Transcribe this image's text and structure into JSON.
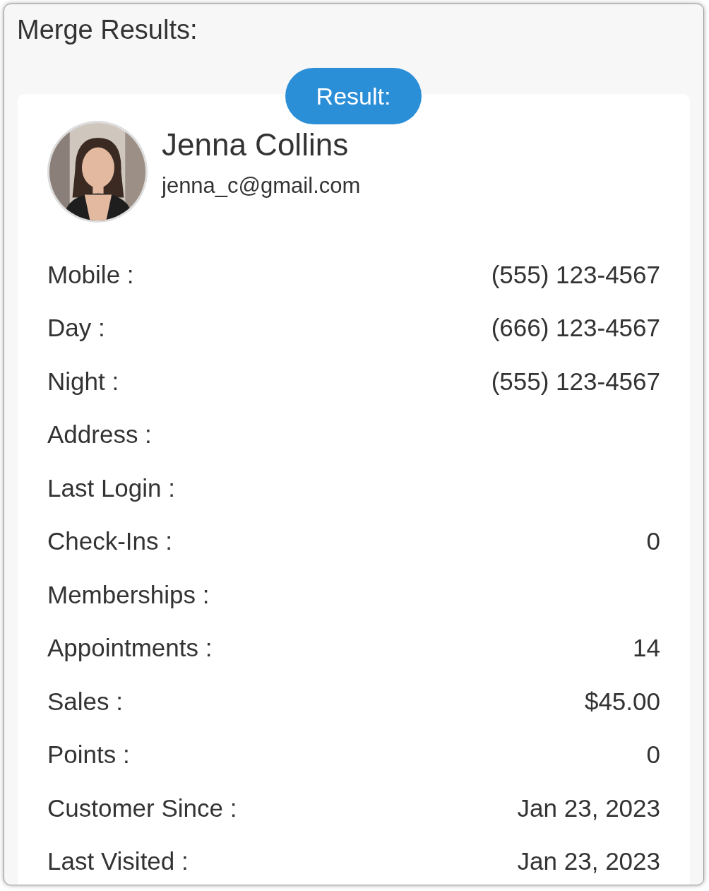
{
  "title": "Merge Results:",
  "result_badge": "Result:",
  "profile": {
    "name": "Jenna Collins",
    "email": "jenna_c@gmail.com"
  },
  "fields": [
    {
      "label": "Mobile :",
      "value": "(555) 123-4567"
    },
    {
      "label": "Day :",
      "value": "(666) 123-4567"
    },
    {
      "label": "Night :",
      "value": "(555) 123-4567"
    },
    {
      "label": "Address :"
    },
    {
      "label": "Last Login :"
    },
    {
      "label": "Check-Ins :",
      "value": "0"
    },
    {
      "label": "Memberships :"
    },
    {
      "label": "Appointments :",
      "value": "14"
    },
    {
      "label": "Sales :",
      "value": "$45.00"
    },
    {
      "label": "Points :",
      "value": "0"
    },
    {
      "label": "Customer Since :",
      "value": "Jan 23, 2023"
    },
    {
      "label": "Last Visited :",
      "value": "Jan 23, 2023"
    }
  ]
}
